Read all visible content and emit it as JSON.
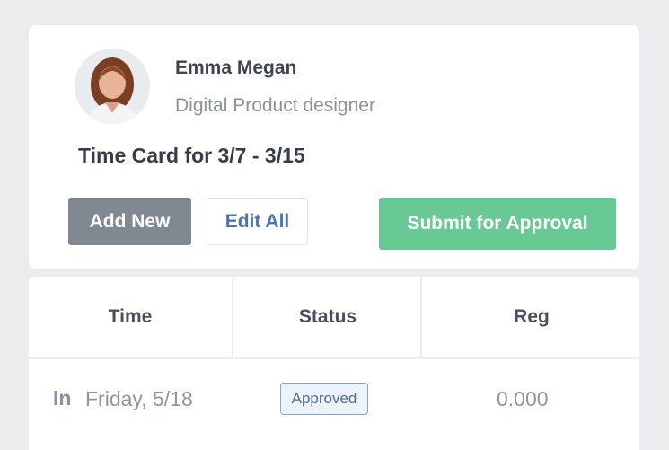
{
  "profile": {
    "name": "Emma Megan",
    "role": "Digital Product designer",
    "avatar_icon": "user-avatar-photo"
  },
  "timecard": {
    "title": "Time Card for 3/7 - 3/15"
  },
  "actions": {
    "add_new": "Add New",
    "edit_all": "Edit All",
    "submit": "Submit for Approval"
  },
  "table": {
    "headers": [
      "Time",
      "Status",
      "Reg"
    ],
    "rows": [
      {
        "direction": "In",
        "date": "Friday, 5/18",
        "status": "Approved",
        "reg": "0.000"
      }
    ]
  },
  "colors": {
    "primary_button": "#808891",
    "success_button": "#68c994",
    "link_text": "#4b73b3",
    "badge_border": "#8aa3cb"
  }
}
